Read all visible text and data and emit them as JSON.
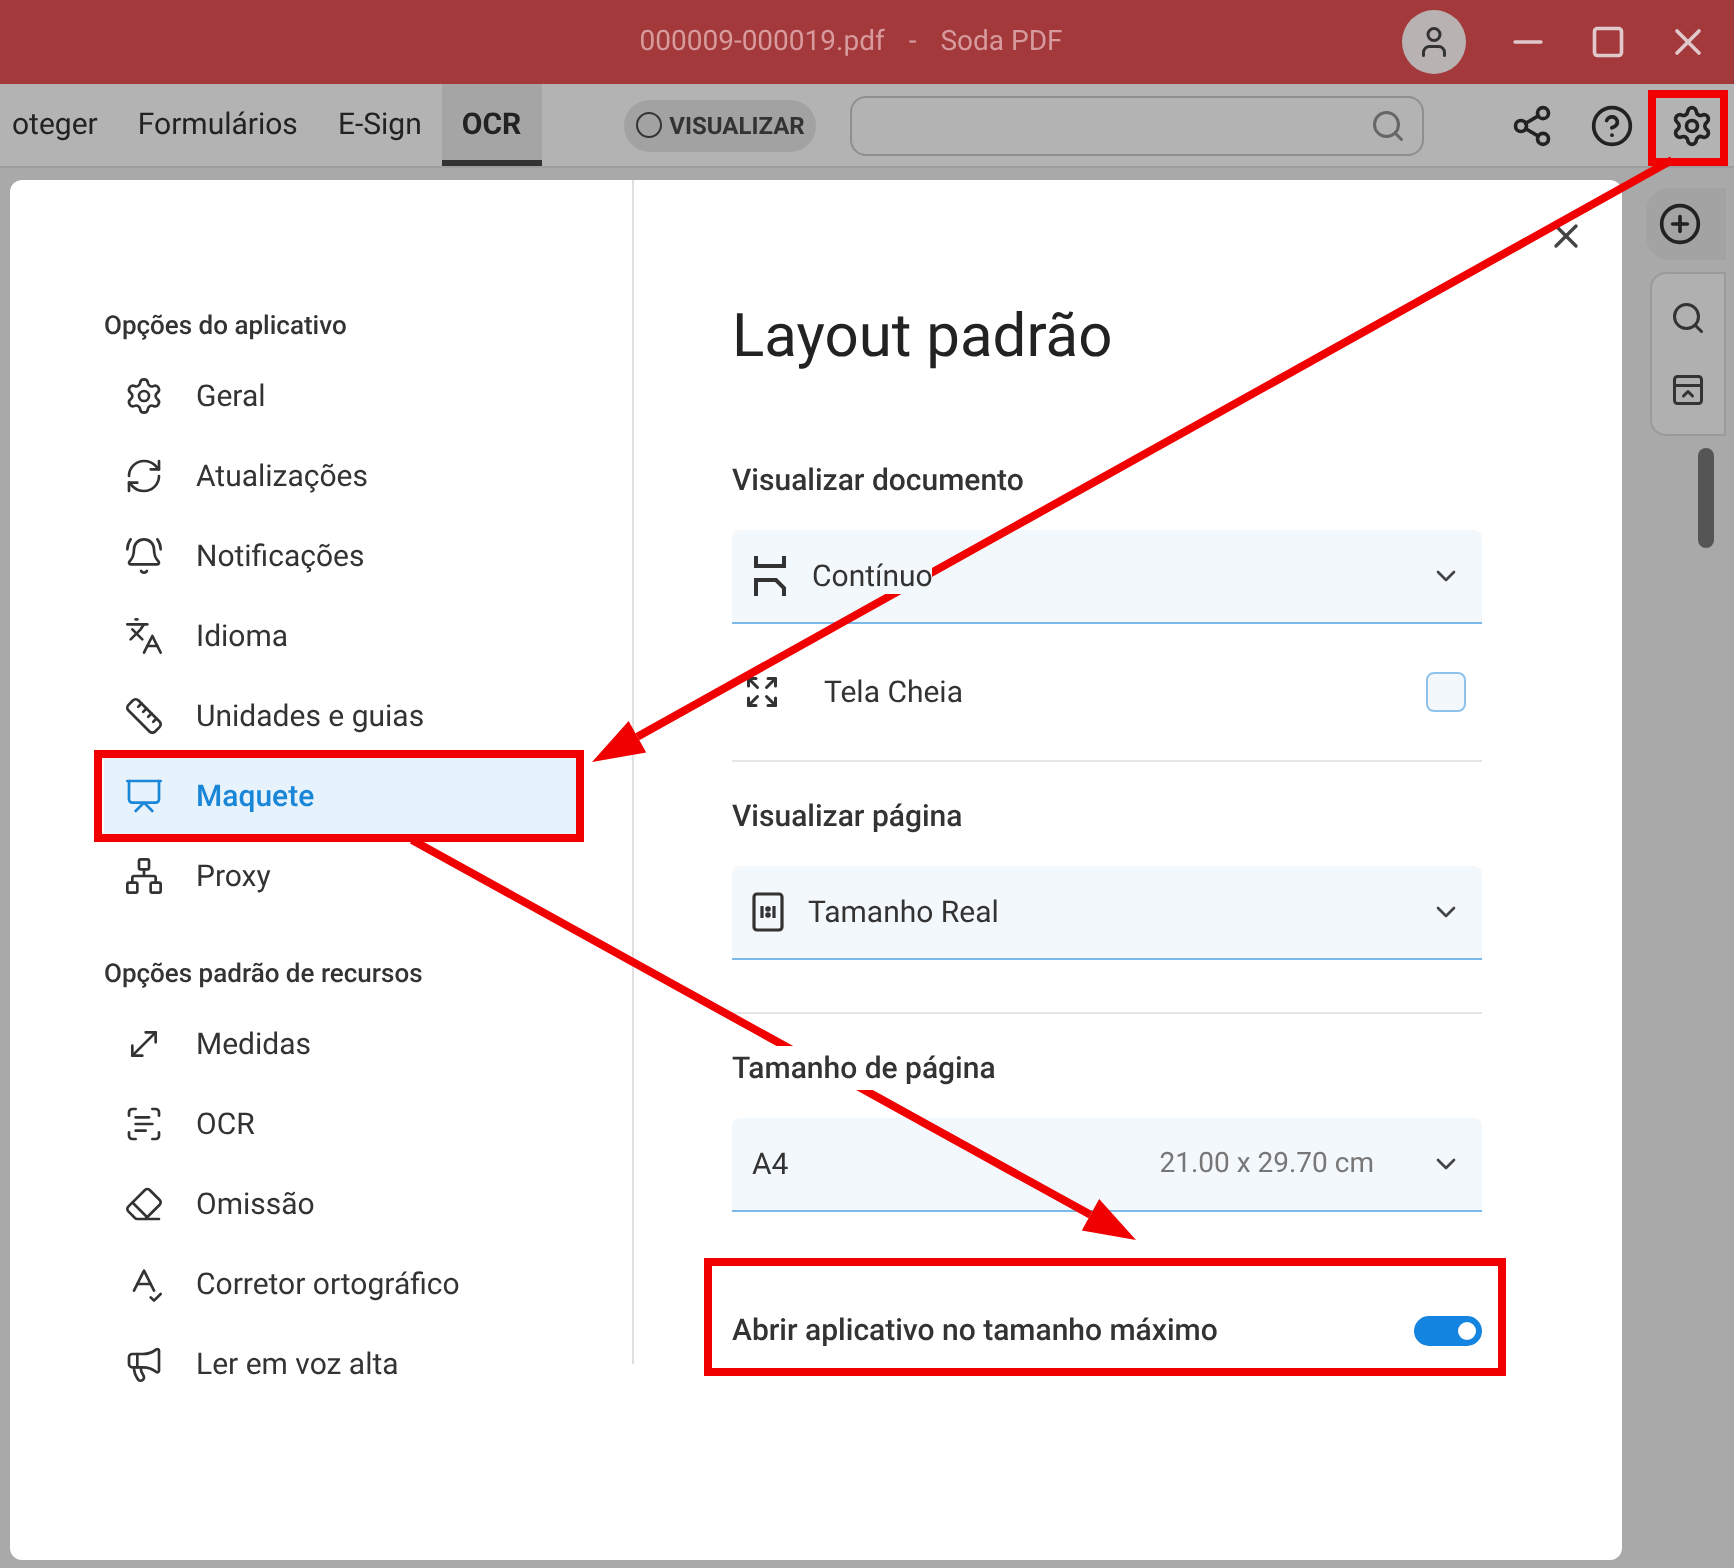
{
  "window": {
    "title_file": "000009-000019.pdf",
    "title_separator": "-",
    "title_app": "Soda PDF"
  },
  "toolbar": {
    "tabs": [
      {
        "label": "oteger",
        "selected": false
      },
      {
        "label": "Formulários",
        "selected": false
      },
      {
        "label": "E-Sign",
        "selected": false
      },
      {
        "label": "OCR",
        "selected": true
      }
    ],
    "view_toggle": {
      "label": "VISUALIZAR",
      "on": false
    }
  },
  "dialog": {
    "sidebar": {
      "sections": [
        {
          "heading": "Opções do aplicativo",
          "items": [
            {
              "label": "Geral",
              "selected": false
            },
            {
              "label": "Atualizações",
              "selected": false
            },
            {
              "label": "Notificações",
              "selected": false
            },
            {
              "label": "Idioma",
              "selected": false
            },
            {
              "label": "Unidades e guias",
              "selected": false
            },
            {
              "label": "Maquete",
              "selected": true
            },
            {
              "label": "Proxy",
              "selected": false
            }
          ]
        },
        {
          "heading": "Opções padrão de recursos",
          "items": [
            {
              "label": "Medidas",
              "selected": false
            },
            {
              "label": "OCR",
              "selected": false
            },
            {
              "label": "Omissão",
              "selected": false
            },
            {
              "label": "Corretor ortográfico",
              "selected": false
            },
            {
              "label": "Ler em voz alta",
              "selected": false
            }
          ]
        }
      ]
    },
    "content": {
      "title": "Layout padrão",
      "sections": [
        {
          "heading": "Visualizar documento",
          "dropdown": {
            "value": "Contínuo"
          },
          "option": {
            "label": "Tela Cheia",
            "checked": false
          }
        },
        {
          "heading": "Visualizar página",
          "dropdown": {
            "value": "Tamanho Real"
          }
        },
        {
          "heading": "Tamanho de página",
          "dropdown": {
            "value": "A4",
            "detail": "21.00 x 29.70 cm"
          }
        }
      ],
      "toggle": {
        "label": "Abrir aplicativo no tamanho máximo",
        "on": true
      }
    }
  }
}
